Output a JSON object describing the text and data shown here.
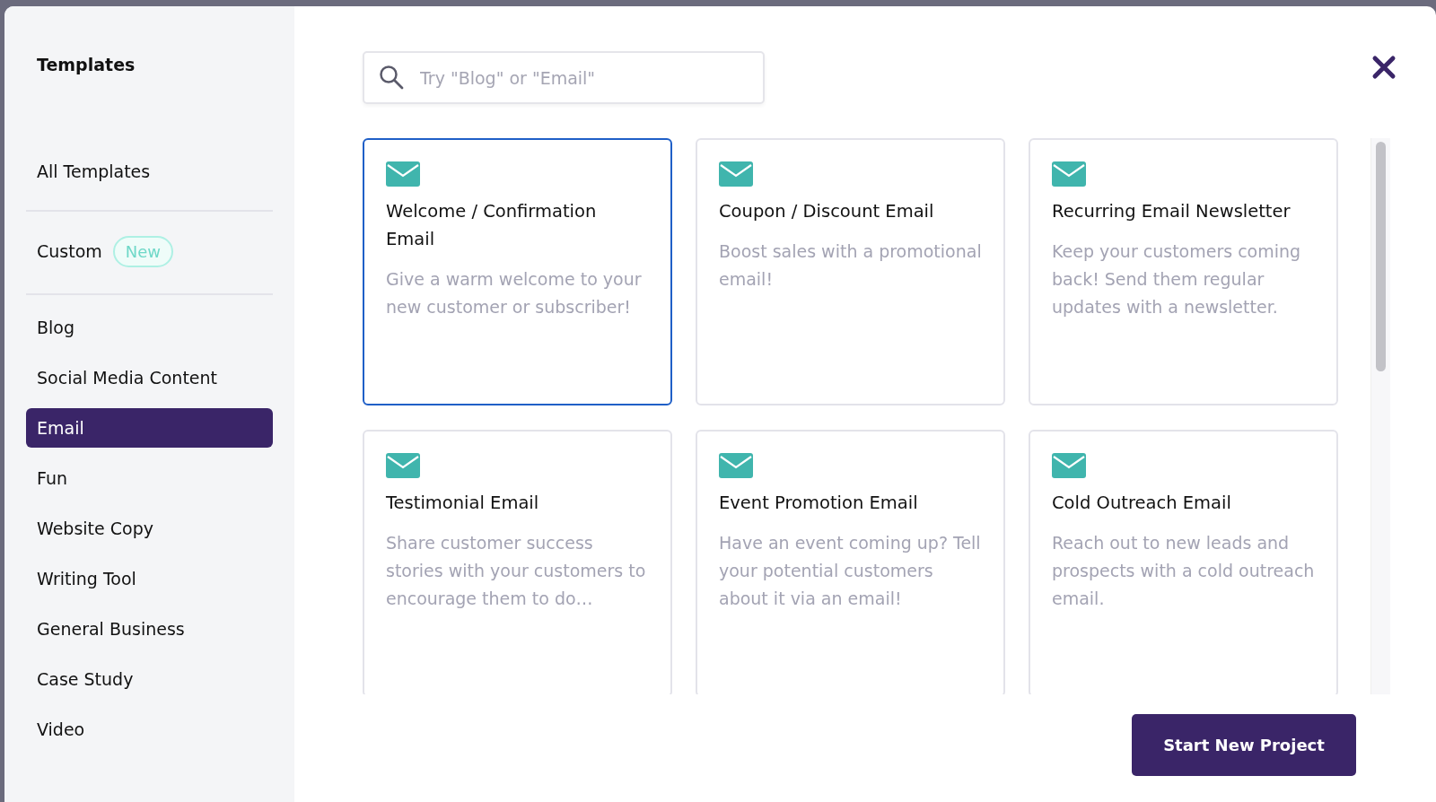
{
  "sidebar": {
    "title": "Templates",
    "sections": [
      [
        {
          "label": "All Templates",
          "selected": false
        }
      ],
      [
        {
          "label": "Custom",
          "badge": "New",
          "selected": false
        }
      ],
      [
        {
          "label": "Blog",
          "selected": false
        },
        {
          "label": "Social Media Content",
          "selected": false
        },
        {
          "label": "Email",
          "selected": true
        },
        {
          "label": "Fun",
          "selected": false
        },
        {
          "label": "Website Copy",
          "selected": false
        },
        {
          "label": "Writing Tool",
          "selected": false
        },
        {
          "label": "General Business",
          "selected": false
        },
        {
          "label": "Case Study",
          "selected": false
        },
        {
          "label": "Video",
          "selected": false
        }
      ]
    ]
  },
  "search": {
    "placeholder": "Try \"Blog\" or \"Email\""
  },
  "templates": [
    {
      "title": "Welcome / Confirmation Email",
      "description": "Give a warm welcome to your new customer or subscriber!",
      "selected": true
    },
    {
      "title": "Coupon / Discount Email",
      "description": "Boost sales with a promotional email!",
      "selected": false
    },
    {
      "title": "Recurring Email Newsletter",
      "description": "Keep your customers coming back! Send them regular updates with a newsletter.",
      "selected": false
    },
    {
      "title": "Testimonial Email",
      "description": "Share customer success stories with your customers to encourage them to do…",
      "selected": false
    },
    {
      "title": "Event Promotion Email",
      "description": "Have an event coming up? Tell your potential customers about it via an email!",
      "selected": false
    },
    {
      "title": "Cold Outreach Email",
      "description": "Reach out to new leads and prospects with a cold outreach email.",
      "selected": false
    }
  ],
  "primary_button": "Start New Project"
}
